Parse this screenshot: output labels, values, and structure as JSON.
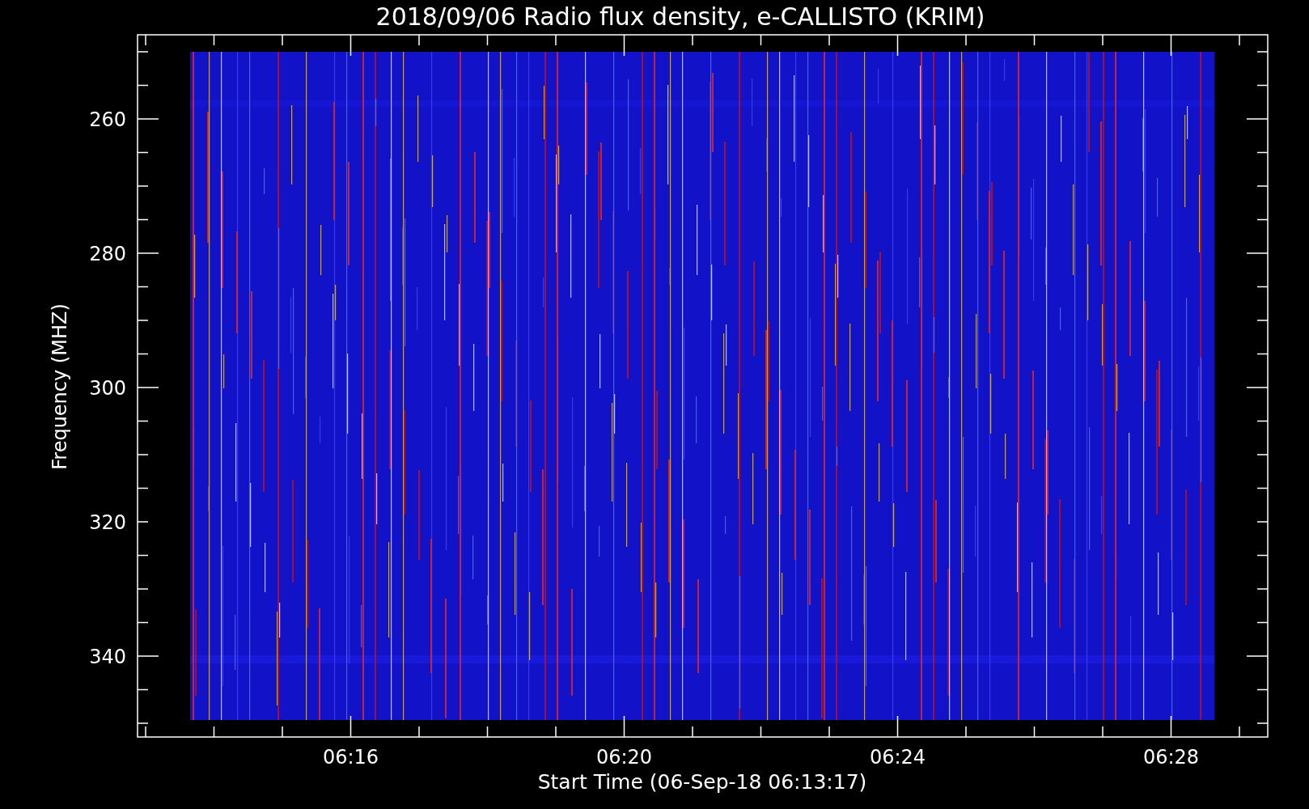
{
  "title": "2018/09/06  Radio flux density, e-CALLISTO (KRIM)",
  "plot": {
    "ylabel": "Frequency (MHZ)",
    "xlabel": "Start Time (06-Sep-18 06:13:17)",
    "y_ticks": [
      "260",
      "280",
      "300",
      "320",
      "340"
    ],
    "x_ticks": [
      "06:16",
      "06:20",
      "06:24",
      "06:28"
    ]
  }
}
